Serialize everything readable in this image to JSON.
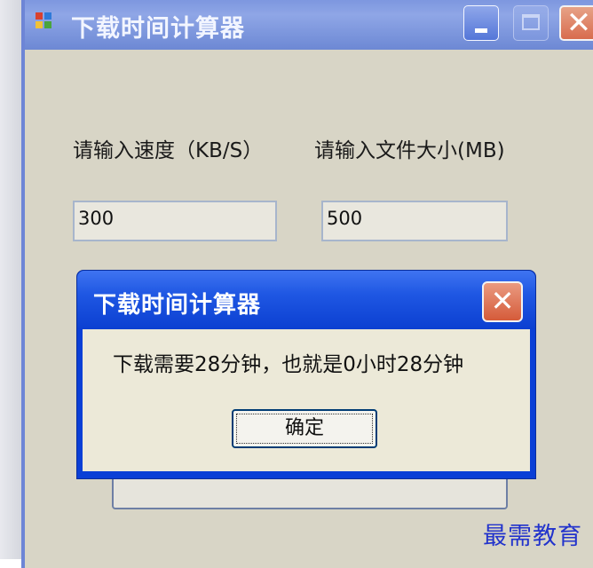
{
  "main_window": {
    "title": "下载时间计算器",
    "speed_label": "请输入速度（KB/S）",
    "size_label": "请输入文件大小(MB)",
    "speed_value": "300",
    "size_value": "500"
  },
  "dialog": {
    "title": "下载时间计算器",
    "message": "下载需要28分钟，也就是0小时28分钟",
    "ok_label": "确定"
  },
  "watermark": "最需教育",
  "icons": {
    "app": "app-icon",
    "minimize": "minimize-icon",
    "maximize": "maximize-icon",
    "close": "close-icon"
  },
  "colors": {
    "titlebar": "#7b95dc",
    "dialog_titlebar": "#1f57e3",
    "client_bg": "#d8d5c6",
    "close_button": "#d86c4e"
  }
}
